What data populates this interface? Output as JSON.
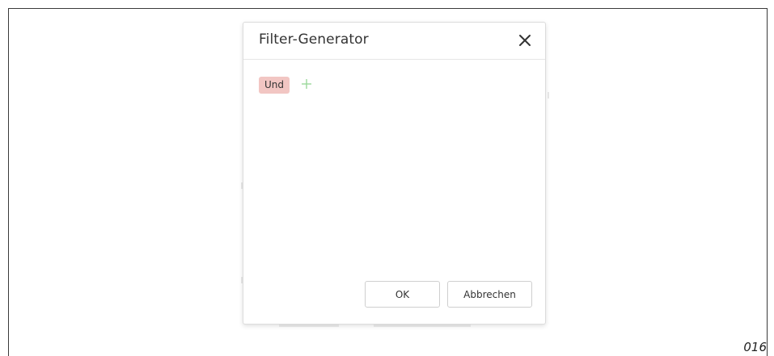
{
  "dialog": {
    "title": "Filter-Generator",
    "close_icon": "close-icon",
    "filter": {
      "group_label": "Und",
      "group_color": "#f2c6c3",
      "add_icon": "plus-icon",
      "add_color": "#9bd89b"
    },
    "buttons": {
      "ok_label": "OK",
      "cancel_label": "Abbrechen"
    }
  },
  "page_label": "016"
}
